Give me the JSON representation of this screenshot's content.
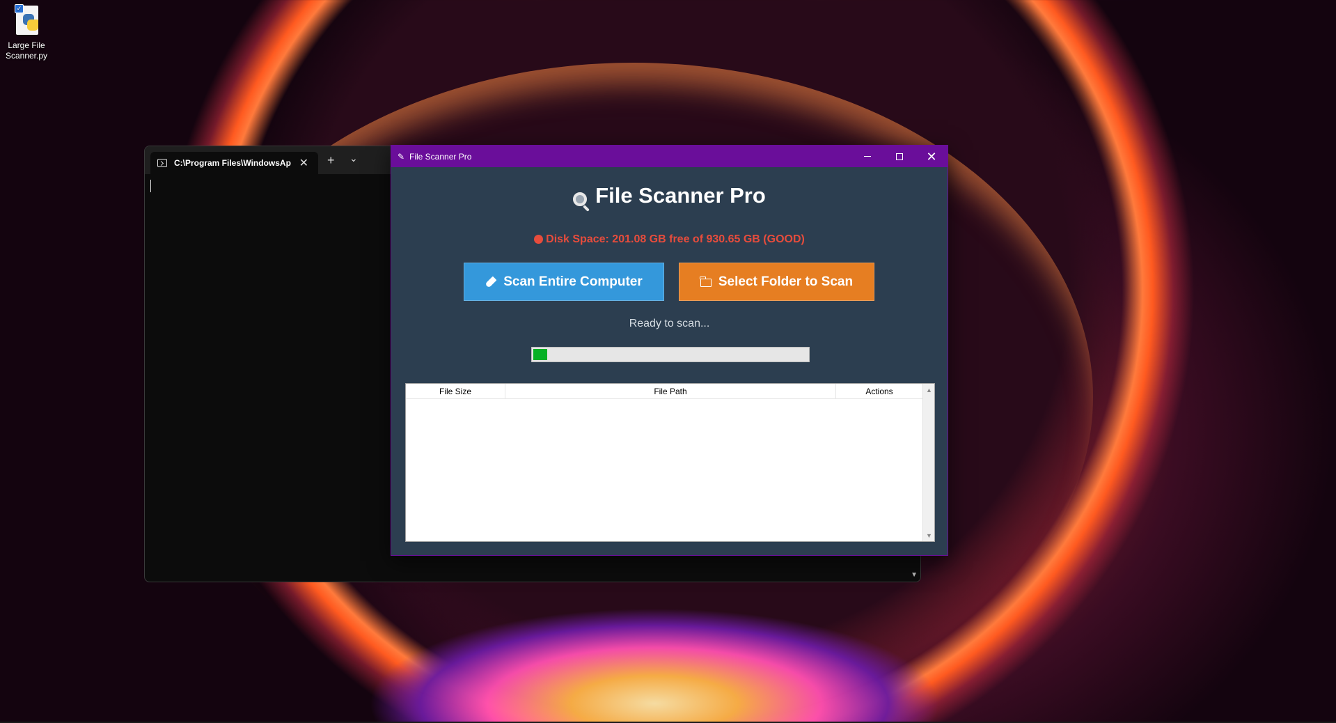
{
  "desktop": {
    "icons": [
      {
        "label": "Large File Scanner.py",
        "icon": "python-file-icon"
      }
    ]
  },
  "terminal": {
    "tab_title": "C:\\Program Files\\WindowsAp",
    "new_tab_glyph": "+",
    "dropdown_glyph": "⌄",
    "close_glyph": "✕"
  },
  "app": {
    "window_title": "File Scanner Pro",
    "heading": "File Scanner Pro",
    "disk_status": "Disk Space: 201.08 GB free of 930.65 GB (GOOD)",
    "disk_status_color": "#e74c3c",
    "buttons": {
      "scan_all": "Scan Entire Computer",
      "select_folder": "Select Folder to Scan"
    },
    "status_text": "Ready to scan...",
    "progress_fraction": 0.05,
    "table": {
      "columns": [
        "File Size",
        "File Path",
        "Actions"
      ],
      "rows": []
    },
    "colors": {
      "titlebar": "#6a0e9a",
      "background": "#2c3e50",
      "scan_button": "#3498db",
      "folder_button": "#e67e22",
      "progress": "#06b025"
    }
  }
}
